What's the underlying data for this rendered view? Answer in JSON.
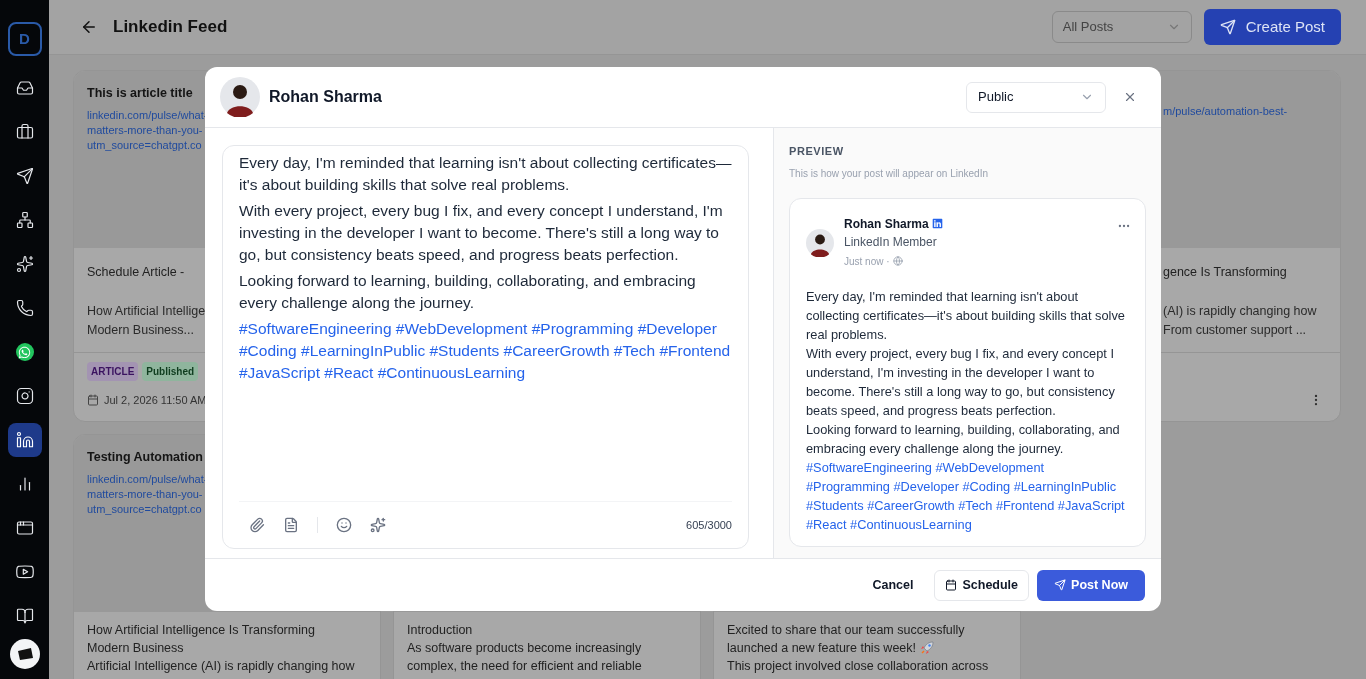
{
  "sidebar": {
    "logo": "D",
    "items": [
      {
        "kind": "inbox",
        "selected": false
      },
      {
        "kind": "briefcase",
        "selected": false
      },
      {
        "kind": "send",
        "selected": false
      },
      {
        "kind": "network",
        "selected": false
      },
      {
        "kind": "sparkles",
        "selected": false
      },
      {
        "kind": "phone",
        "selected": false
      },
      {
        "kind": "whatsapp",
        "selected": false
      },
      {
        "kind": "instagram",
        "selected": false
      },
      {
        "kind": "linkedin",
        "selected": true
      },
      {
        "kind": "chart",
        "selected": false
      },
      {
        "kind": "window",
        "selected": false
      },
      {
        "kind": "youtube",
        "selected": false
      },
      {
        "kind": "book",
        "selected": false
      }
    ]
  },
  "header": {
    "title": "Linkedin Feed",
    "filter": {
      "value": "All Posts"
    },
    "create_button": "Create Post"
  },
  "feed": {
    "rows": [
      [
        {
          "kind": "post",
          "title": "This is article title",
          "link_lines": [
            "linkedin.com/pulse/what-",
            "matters-more-than-you-",
            "utm_source=chatgpt.co"
          ],
          "subtitle": "Schedule Article -",
          "excerpt_lines": [
            "How Artificial Intellige",
            "Modern Business..."
          ],
          "badges": [
            {
              "label": "ARTICLE",
              "color": "#a394b2"
            },
            {
              "label": "Published",
              "color": "#8fb59d"
            }
          ],
          "date": "Jul 2, 2026 11:50 AM"
        },
        {
          "kind": "covered"
        },
        {
          "kind": "covered"
        },
        {
          "kind": "post_edge",
          "link_lines": [
            "m/pulse/automation-best-"
          ],
          "subtitle": "gence Is Transforming",
          "excerpt_lines": [
            "(AI) is rapidly changing how",
            "From customer support ..."
          ]
        }
      ],
      [
        {
          "kind": "post_image",
          "title": "Testing Automation",
          "link_lines": [
            "linkedin.com/pulse/what-",
            "matters-more-than-you-",
            "utm_source=chatgpt.co"
          ],
          "body_lines": [
            "How Artificial Intelligence Is Transforming",
            "Modern Business",
            "Artificial Intelligence (AI) is rapidly changing how"
          ]
        },
        {
          "kind": "post_bottom",
          "body_lines": [
            "Introduction",
            "As software products become increasingly",
            "complex, the need for efficient and reliable"
          ]
        },
        {
          "kind": "post_bottom",
          "body_lines": [
            {
              "kind": "text",
              "text": "Excited to share that our team successfully"
            },
            {
              "kind": "text_rocket",
              "text": "launched a new feature this week!"
            },
            {
              "kind": "text",
              "text": "This project involved close collaboration across"
            }
          ]
        }
      ]
    ]
  },
  "modal": {
    "author": "Rohan Sharma",
    "visibility": "Public",
    "editor": {
      "paragraphs": [
        "Every day, I'm reminded that learning isn't about collecting certificates—it's about building skills that solve real problems.",
        "With every project, every bug I fix, and every concept I understand, I'm investing in the developer I want to become. There's still a long way to go, but consistency beats speed, and progress beats perfection.",
        "Looking forward to learning, building, collaborating, and embracing every challenge along the journey."
      ],
      "hashtags": "#SoftwareEngineering #WebDevelopment #Programming #Developer #Coding #LearningInPublic #Students #CareerGrowth #Tech #Frontend #JavaScript #React #ContinuousLearning",
      "count": "605/3000"
    },
    "preview": {
      "label": "PREVIEW",
      "hint": "This is how your post will appear on LinkedIn",
      "name": "Rohan Sharma",
      "role": "LinkedIn Member",
      "time": "Just now ·",
      "paragraphs": [
        "Every day, I'm reminded that learning isn't about collecting certificates—it's about building skills that solve real problems.",
        "With every project, every bug I fix, and every concept I understand, I'm investing in the developer I want to become. There's still a long way to go, but consistency beats speed, and progress beats perfection.",
        "Looking forward to learning, building, collaborating, and embracing every challenge along the journey."
      ],
      "hashtags": "#SoftwareEngineering #WebDevelopment #Programming #Developer #Coding #LearningInPublic #Students #CareerGrowth #Tech #Frontend #JavaScript #React #ContinuousLearning"
    },
    "footer": {
      "cancel": "Cancel",
      "schedule": "Schedule",
      "post": "Post Now"
    }
  }
}
